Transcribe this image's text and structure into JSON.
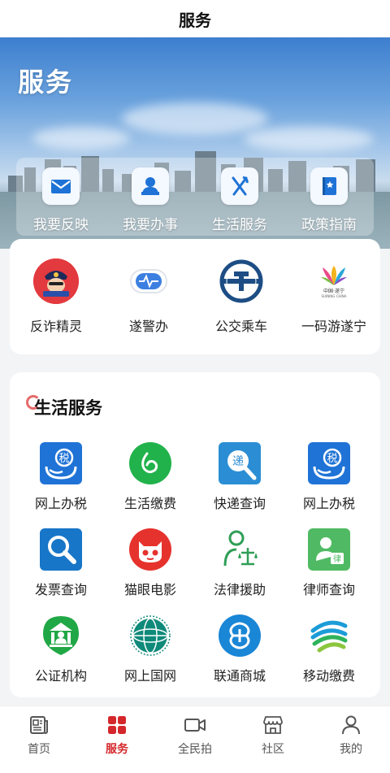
{
  "header": {
    "title": "服务"
  },
  "banner": {
    "title": "服务"
  },
  "quick_actions": [
    {
      "label": "我要反映",
      "icon": "mail-icon"
    },
    {
      "label": "我要办事",
      "icon": "person-desk-icon"
    },
    {
      "label": "生活服务",
      "icon": "fork-knife-icon"
    },
    {
      "label": "政策指南",
      "icon": "guide-book-icon"
    }
  ],
  "featured_apps": [
    {
      "label": "反诈精灵",
      "icon": "police-mascot-icon"
    },
    {
      "label": "遂警办",
      "icon": "police-chat-icon"
    },
    {
      "label": "公交乘车",
      "icon": "bus-logo-icon"
    },
    {
      "label": "一码游遂宁",
      "icon": "tourism-logo-icon",
      "logo_text_cn": "中国·遂宁",
      "logo_text_en": "SUINING CHINA"
    }
  ],
  "life_services": {
    "title": "生活服务",
    "items": [
      {
        "label": "网上办税",
        "icon": "tax-icon"
      },
      {
        "label": "生活缴费",
        "icon": "payment-icon"
      },
      {
        "label": "快递查询",
        "icon": "express-search-icon",
        "glyph": "递"
      },
      {
        "label": "网上办税",
        "icon": "tax-icon"
      },
      {
        "label": "发票查询",
        "icon": "invoice-search-icon"
      },
      {
        "label": "猫眼电影",
        "icon": "maoyan-cat-icon"
      },
      {
        "label": "法律援助",
        "icon": "legal-aid-icon"
      },
      {
        "label": "律师查询",
        "icon": "lawyer-search-icon",
        "glyph": "律"
      },
      {
        "label": "公证机构",
        "icon": "notary-icon"
      },
      {
        "label": "网上国网",
        "icon": "state-grid-icon"
      },
      {
        "label": "联通商城",
        "icon": "unicom-icon"
      },
      {
        "label": "移动缴费",
        "icon": "china-mobile-icon"
      }
    ],
    "tax_glyph": "税"
  },
  "tabbar": [
    {
      "label": "首页",
      "icon": "news-icon",
      "active": false
    },
    {
      "label": "服务",
      "icon": "grid-icon",
      "active": true
    },
    {
      "label": "全民拍",
      "icon": "video-camera-icon",
      "active": false
    },
    {
      "label": "社区",
      "icon": "store-icon",
      "active": false
    },
    {
      "label": "我的",
      "icon": "user-icon",
      "active": false
    }
  ],
  "colors": {
    "accent": "#d4272b",
    "primary_blue": "#1f73d6",
    "panel_bg": "#f3f4f6"
  }
}
